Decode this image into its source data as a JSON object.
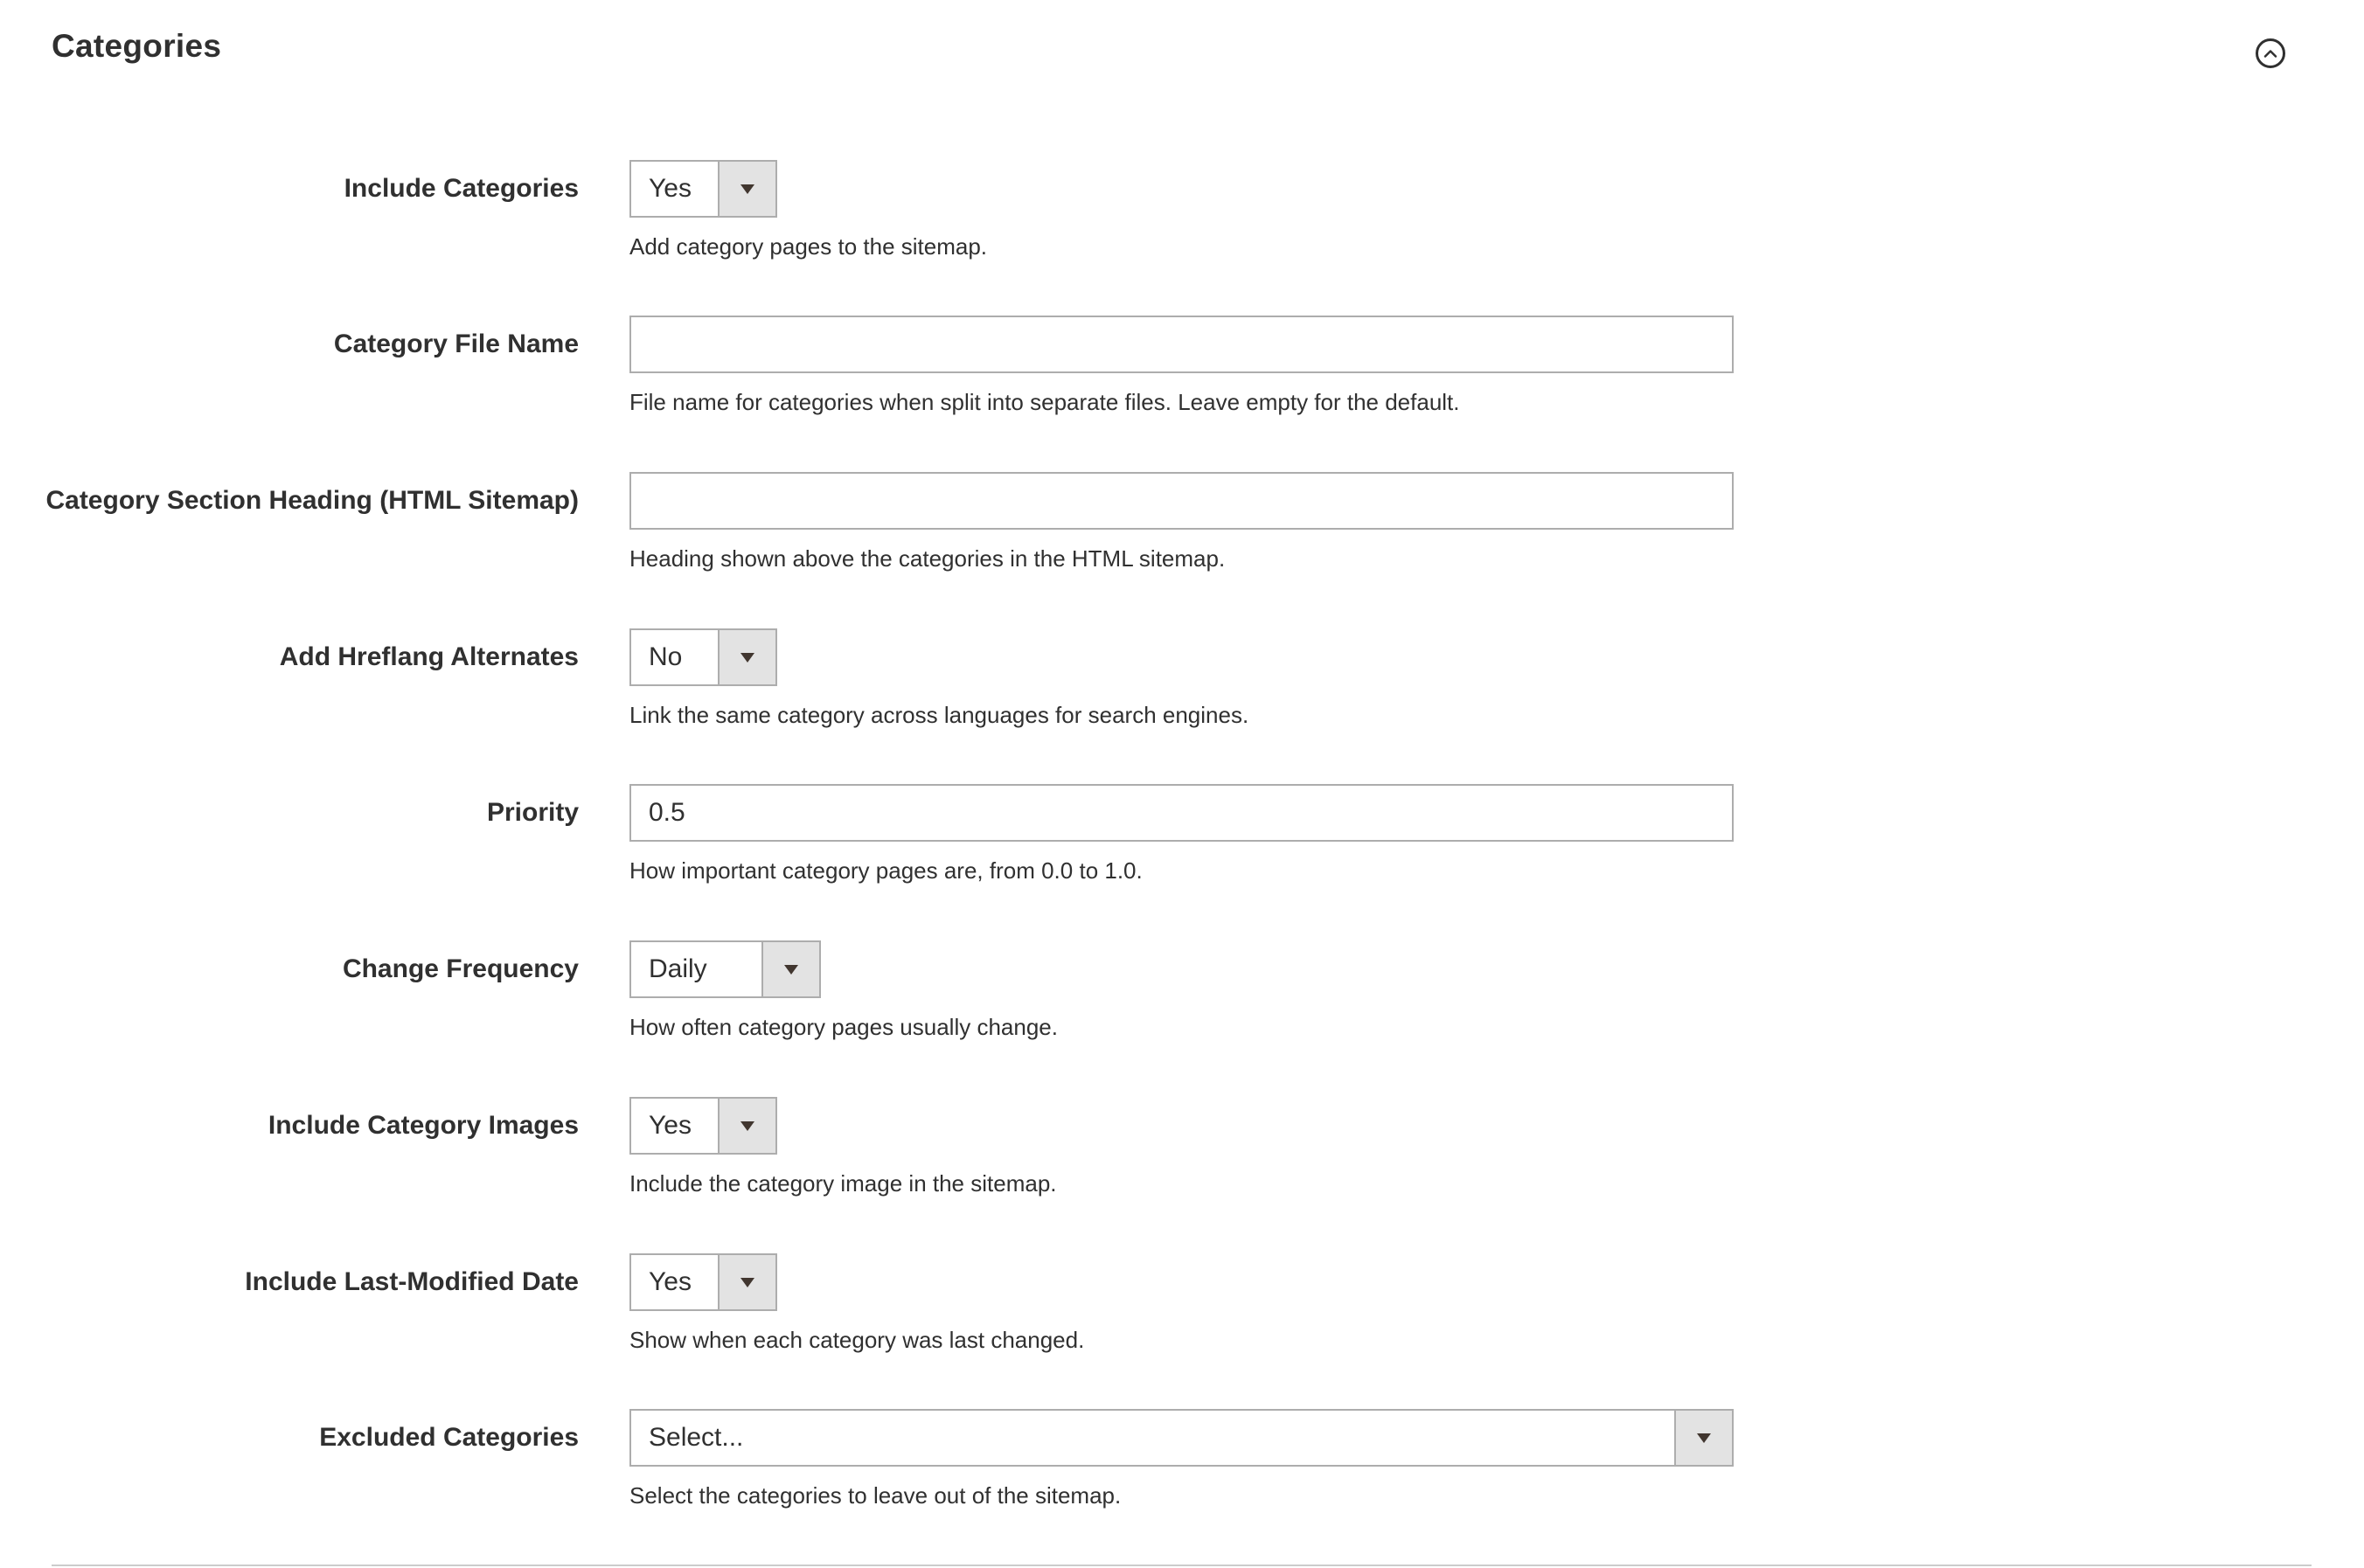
{
  "section": {
    "title": "Categories"
  },
  "fields": {
    "include_categories": {
      "label": "Include Categories",
      "value": "Yes",
      "note": "Add category pages to the sitemap."
    },
    "category_file_name": {
      "label": "Category File Name",
      "value": "",
      "note": "File name for categories when split into separate files. Leave empty for the default."
    },
    "category_section_heading": {
      "label": "Category Section Heading (HTML Sitemap)",
      "value": "",
      "note": "Heading shown above the categories in the HTML sitemap."
    },
    "add_hreflang": {
      "label": "Add Hreflang Alternates",
      "value": "No",
      "note": "Link the same category across languages for search engines."
    },
    "priority": {
      "label": "Priority",
      "value": "0.5",
      "note": "How important category pages are, from 0.0 to 1.0."
    },
    "change_frequency": {
      "label": "Change Frequency",
      "value": "Daily",
      "note": "How often category pages usually change."
    },
    "include_category_images": {
      "label": "Include Category Images",
      "value": "Yes",
      "note": "Include the category image in the sitemap."
    },
    "include_last_modified": {
      "label": "Include Last-Modified Date",
      "value": "Yes",
      "note": "Show when each category was last changed."
    },
    "excluded_categories": {
      "label": "Excluded Categories",
      "value": "Select...",
      "note": "Select the categories to leave out of the sitemap."
    }
  },
  "icons": {
    "collapse": "chevron-up-circle-icon",
    "dropdown": "caret-down-icon"
  },
  "colors": {
    "text": "#303030",
    "border": "#adadad",
    "arrow_bg": "#e3e3e3",
    "divider": "#cccccc"
  }
}
